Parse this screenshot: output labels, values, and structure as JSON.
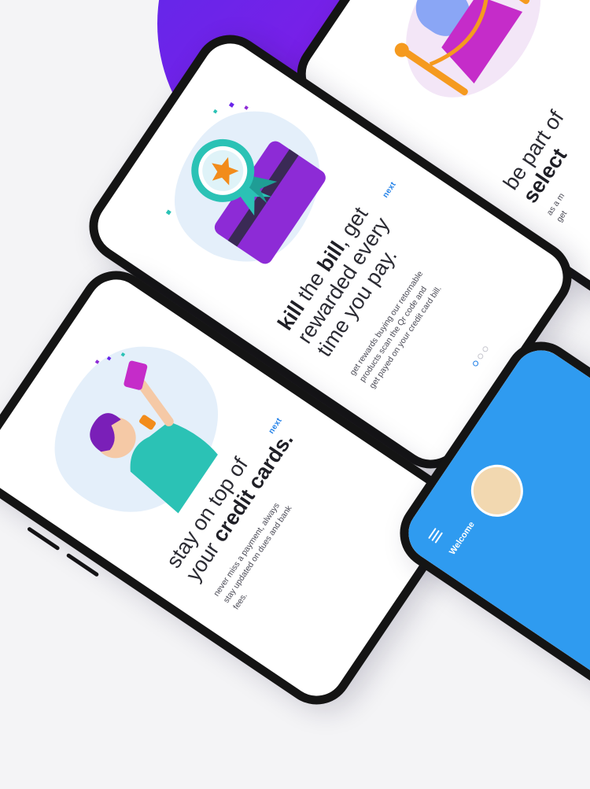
{
  "screens": {
    "rewards": {
      "headline_bold_1": "kill",
      "headline_mid_1": " the ",
      "headline_bold_2": "bill",
      "headline_mid_2": ", get",
      "headline_line_2": "rewarded every",
      "headline_line_3": "time you pay.",
      "body_line_1": "get rewards buying our retornable",
      "body_line_2": "products scan the Qr code and",
      "body_line_3": "get payed on your credit card bill.",
      "next_label": "next",
      "page_indicator": {
        "current": 1,
        "total": 3
      }
    },
    "credit_cards": {
      "headline_line_1": "stay on top of",
      "headline_line_2_plain": "your ",
      "headline_line_2_bold": "credit cards.",
      "body_line_1": "never miss a payment, always",
      "body_line_2": "stay updated on dues and bank",
      "body_line_3": "fees.",
      "next_label": "next"
    },
    "select": {
      "headline_line_1": "be part of",
      "headline_line_2_bold": "select",
      "body_line_1": "as a m",
      "body_line_2": "get"
    },
    "welcome": {
      "title": "Welcome"
    }
  },
  "colors": {
    "brand_purple": "#6a25ea",
    "accent_blue": "#1f7fe8",
    "welcome_blue": "#2f9bf0",
    "star_orange": "#f28c1b",
    "teal": "#2bc2b5"
  }
}
